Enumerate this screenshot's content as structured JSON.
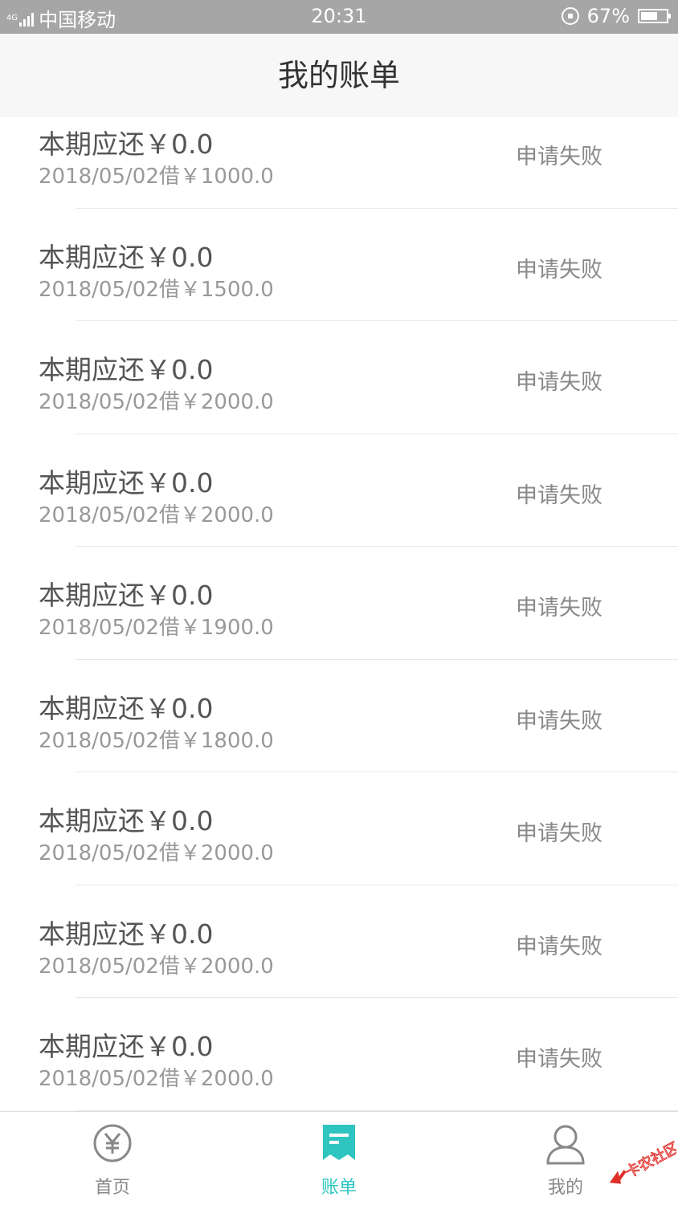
{
  "status_bar": {
    "network": "4G",
    "carrier": "中国移动",
    "time": "20:31",
    "battery": "67%",
    "battery_level": 0.67
  },
  "header": {
    "title": "我的账单"
  },
  "bills": [
    {
      "title": "本期应还￥0.0",
      "sub": "2018/05/02借￥1000.0",
      "status": "申请失败"
    },
    {
      "title": "本期应还￥0.0",
      "sub": "2018/05/02借￥1500.0",
      "status": "申请失败"
    },
    {
      "title": "本期应还￥0.0",
      "sub": "2018/05/02借￥2000.0",
      "status": "申请失败"
    },
    {
      "title": "本期应还￥0.0",
      "sub": "2018/05/02借￥2000.0",
      "status": "申请失败"
    },
    {
      "title": "本期应还￥0.0",
      "sub": "2018/05/02借￥1900.0",
      "status": "申请失败"
    },
    {
      "title": "本期应还￥0.0",
      "sub": "2018/05/02借￥1800.0",
      "status": "申请失败"
    },
    {
      "title": "本期应还￥0.0",
      "sub": "2018/05/02借￥2000.0",
      "status": "申请失败"
    },
    {
      "title": "本期应还￥0.0",
      "sub": "2018/05/02借￥2000.0",
      "status": "申请失败"
    },
    {
      "title": "本期应还￥0.0",
      "sub": "2018/05/02借￥2000.0",
      "status": "申请失败"
    }
  ],
  "tabbar": {
    "tabs": [
      {
        "label": "首页",
        "icon": "yuan-circle-icon",
        "active": false
      },
      {
        "label": "账单",
        "icon": "bill-icon",
        "active": true
      },
      {
        "label": "我的",
        "icon": "user-icon",
        "active": false
      }
    ],
    "active_color": "#2ec5c0",
    "inactive_color": "#888888"
  },
  "watermark": {
    "text": "卡农社区",
    "icon": "kanong-logo-icon"
  }
}
